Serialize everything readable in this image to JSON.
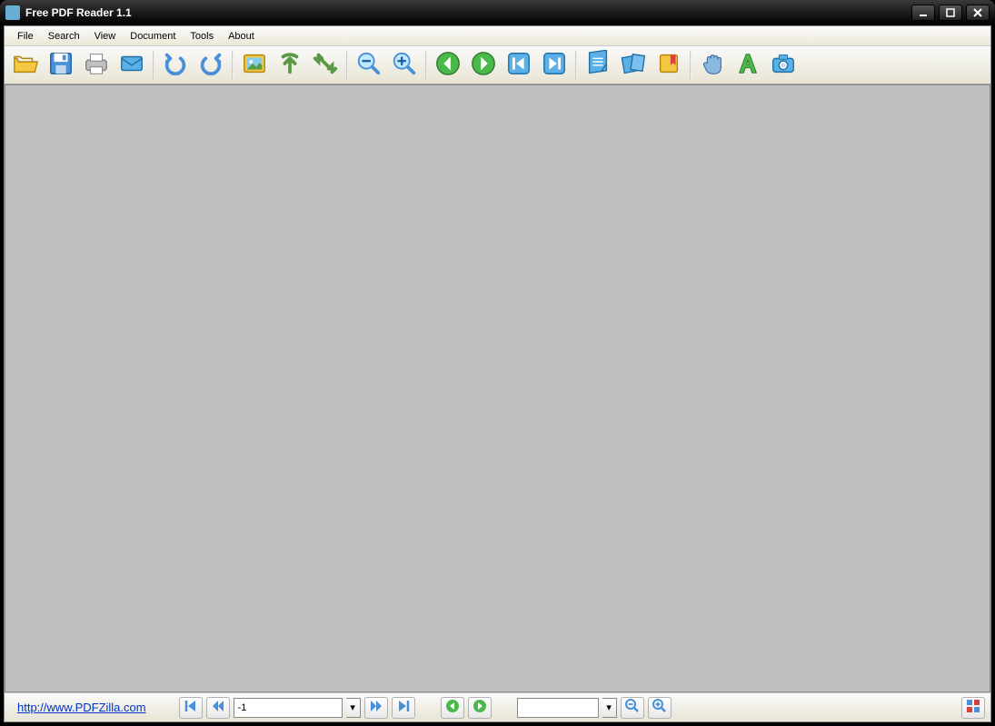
{
  "title": "Free PDF Reader 1.1",
  "menus": {
    "file": "File",
    "search": "Search",
    "view": "View",
    "document": "Document",
    "tools": "Tools",
    "about": "About"
  },
  "toolbar": {
    "open": "open",
    "save": "save",
    "print": "print",
    "email": "email",
    "undo": "undo",
    "redo": "redo",
    "image": "image",
    "rotate_ccw": "rotate-ccw",
    "rotate_cw": "rotate-cw",
    "zoom_out": "zoom-out",
    "zoom_in": "zoom-in",
    "prev": "previous",
    "next": "next",
    "first": "first-page",
    "last": "last-page",
    "single": "single-page",
    "continuous": "continuous",
    "bookmark": "bookmark",
    "hand": "hand-tool",
    "text": "text-select",
    "snapshot": "snapshot"
  },
  "status": {
    "link": "http://www.PDFZilla.com",
    "page_value": "-1",
    "zoom_value": ""
  }
}
